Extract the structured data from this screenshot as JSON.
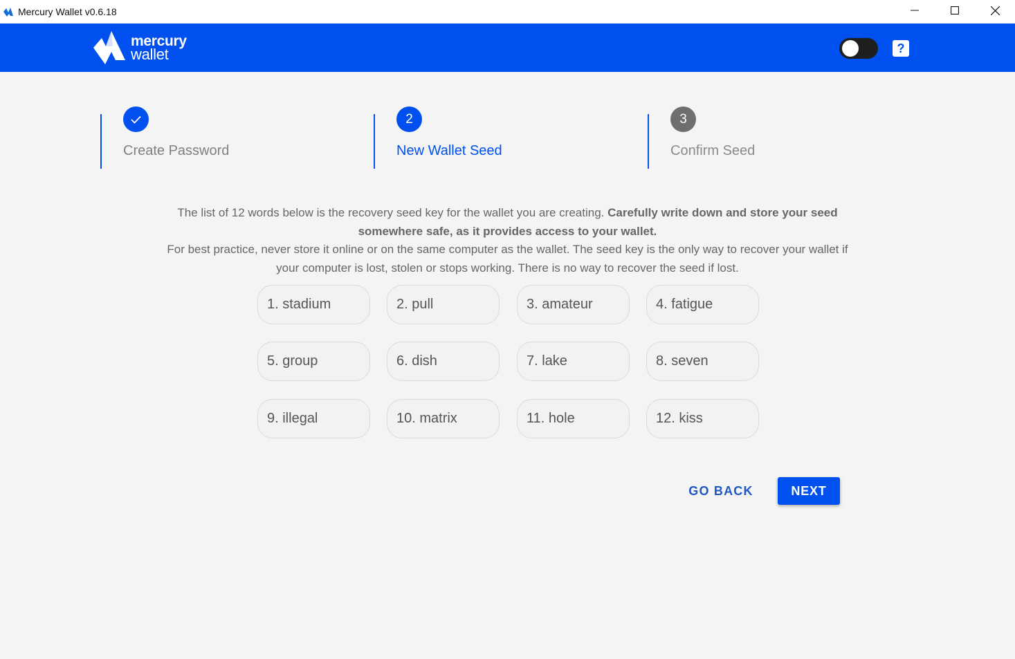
{
  "window": {
    "title": "Mercury Wallet v0.6.18",
    "controls": [
      "minimize-icon",
      "maximize-icon",
      "close-icon"
    ]
  },
  "header": {
    "logo_line1": "mercury",
    "logo_line2": "wallet",
    "help_label": "?",
    "theme_toggle_on": false
  },
  "steps": [
    {
      "number": "✓",
      "label": "Create Password",
      "state": "complete"
    },
    {
      "number": "2",
      "label": "New Wallet Seed",
      "state": "active"
    },
    {
      "number": "3",
      "label": "Confirm Seed",
      "state": "pending"
    }
  ],
  "description": {
    "part1": "The list of 12 words below is the recovery seed key for the wallet you are creating. ",
    "bold": "Carefully write down and store your seed somewhere safe, as it provides access to your wallet.",
    "part2": "For best practice, never store it online or on the same computer as the wallet. The seed key is the only way to recover your wallet if your computer is lost, stolen or stops working. There is no way to recover the seed if lost."
  },
  "seed_words": [
    "1. stadium",
    "2. pull",
    "3. amateur",
    "4. fatigue",
    "5. group",
    "6. dish",
    "7. lake",
    "8. seven",
    "9. illegal",
    "10. matrix",
    "11. hole",
    "12. kiss"
  ],
  "buttons": {
    "go_back": "GO BACK",
    "next": "NEXT"
  },
  "colors": {
    "accent": "#0050f0",
    "pending_step": "#6e6e6e"
  }
}
